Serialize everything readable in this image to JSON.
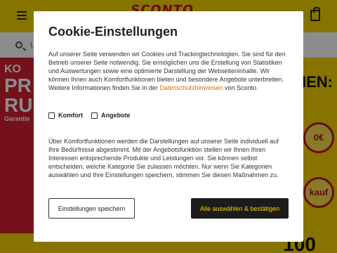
{
  "background": {
    "menu_text": "",
    "logo_text": "SCONTO",
    "search_placeholder": "L",
    "promo": {
      "left_line1": "KO",
      "left_line2": "PR",
      "left_line3": "RU",
      "left_small": "Garantie",
      "right_text": "NEN:",
      "badge1": "0€",
      "badge2": "kauf",
      "big_number": "100"
    },
    "colors": {
      "brand_yellow": "#f5d400",
      "brand_red": "#c0142a"
    }
  },
  "dialog": {
    "title": "Cookie-Einstellungen",
    "intro_text": "Auf unserer Seite verwenden wir Cookies und Trackingtechnologien. Sie sind für den Betrieb unserer Seite notwendig. Sie ermöglichen uns die Erstellung von Statistiken und Auswertungen sowie eine optimierte Darstellung der Webseiteninhalte. Wir können Ihnen auch Komfortfunktionen bieten und besondere Angebote unterbreiten. Weitere Informationen finden Sie in der",
    "link_text": "Datenschutzhinweisen",
    "intro_suffix": "von Sconto.",
    "checkboxes": [
      {
        "label": "Komfort",
        "checked": false
      },
      {
        "label": "Angebote",
        "checked": false
      }
    ],
    "detail_text": "Über Komfortfunktionen werden die Darstellungen auf unserer Seite individuell auf Ihre Bedürfnisse abgestimmt. Mit der Angebotsfunktion stellen wir Ihnen Ihren Interessen entsprechende Produkte und Leistungen vor. Sie können selbst entscheiden, welche Kategorie Sie zulassen möchten. Nur wenn Sie Kategorien auswählen und Ihre Einstellungen speichern, stimmen Sie diesen Maßnahmen zu.",
    "buttons": {
      "save": "Einstellungen speichern",
      "accept_all": "Alle auswählen & bestätigen"
    },
    "colors": {
      "link": "#e36b00",
      "primary_bg": "#1c1c1c",
      "primary_text": "#f5d400"
    }
  }
}
